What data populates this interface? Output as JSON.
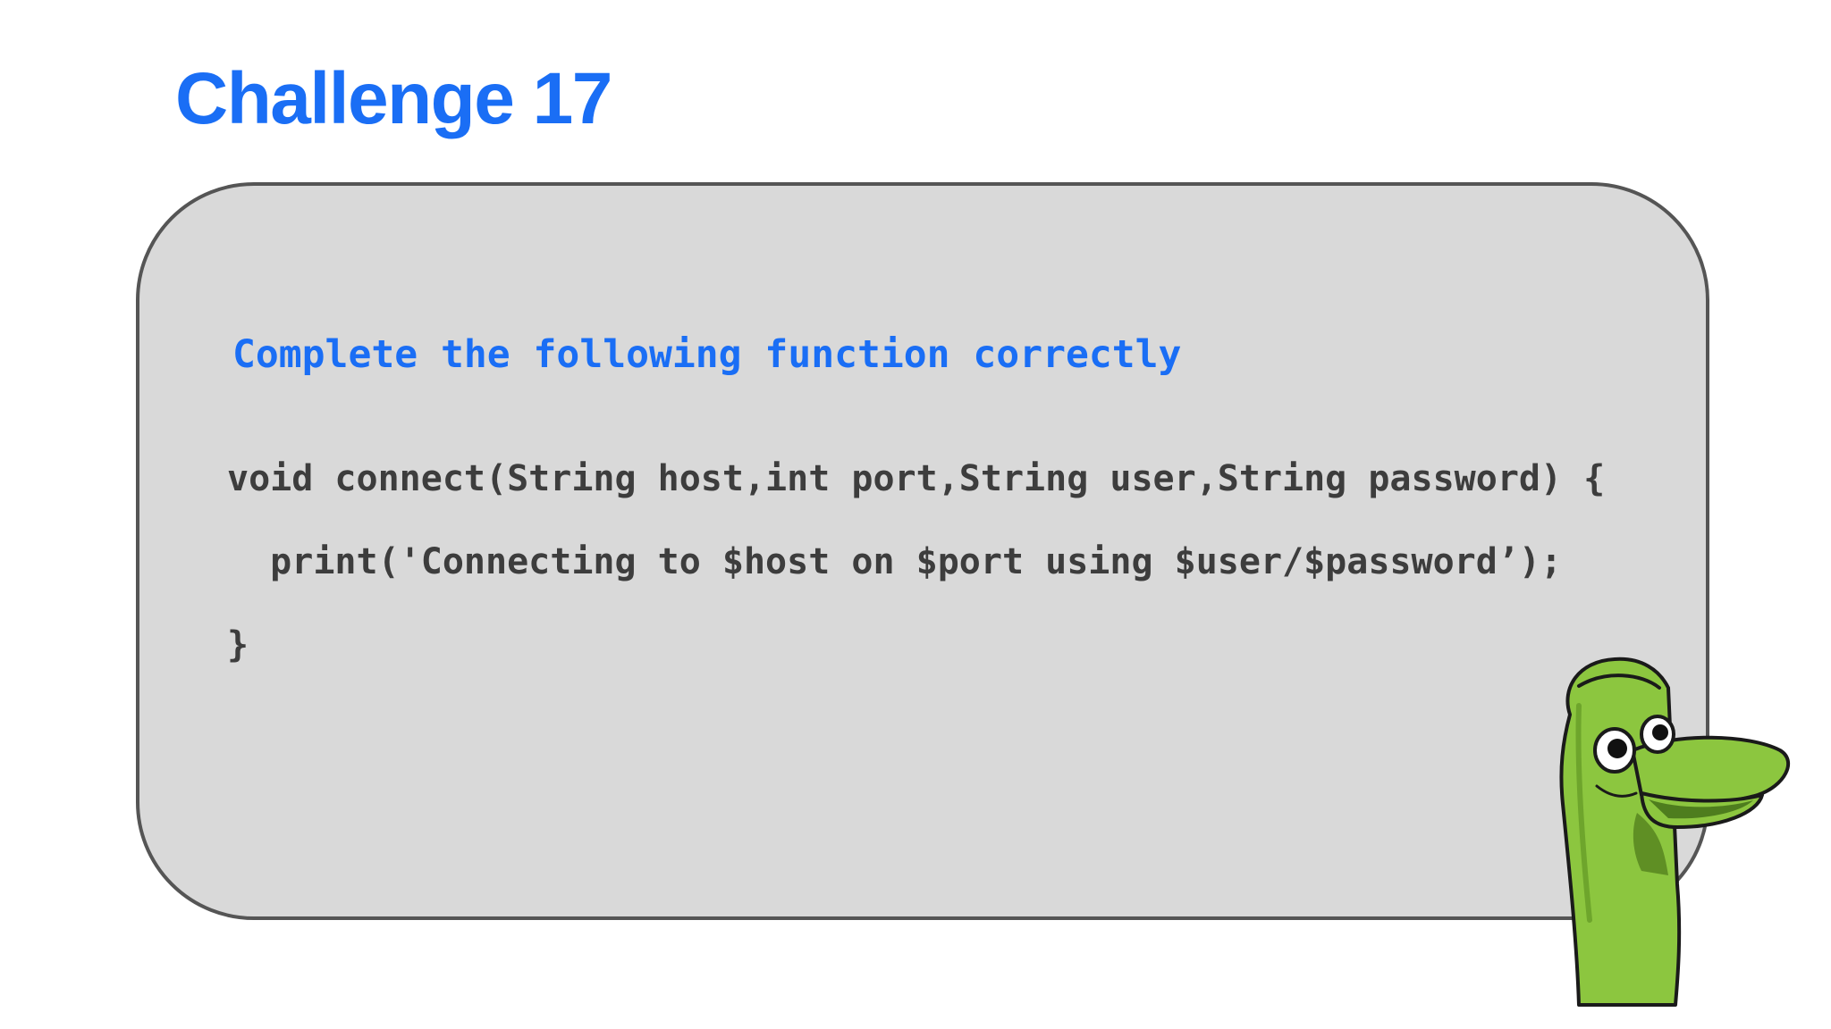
{
  "slide": {
    "title": "Challenge 17",
    "prompt": "Complete the following function correctly",
    "code_lines": [
      "void connect(String host,int port,String user,String password) {",
      "  print('Connecting to $host on $port using $user/$password’);",
      "}"
    ]
  },
  "colors": {
    "accent": "#1a6ef5",
    "card_background": "#d9d9d9",
    "card_border": "#555555",
    "code_text": "#3d3d3d",
    "mascot_green": "#8cc63f"
  },
  "icons": {
    "mascot": "green-sock-puppet-mascot"
  }
}
